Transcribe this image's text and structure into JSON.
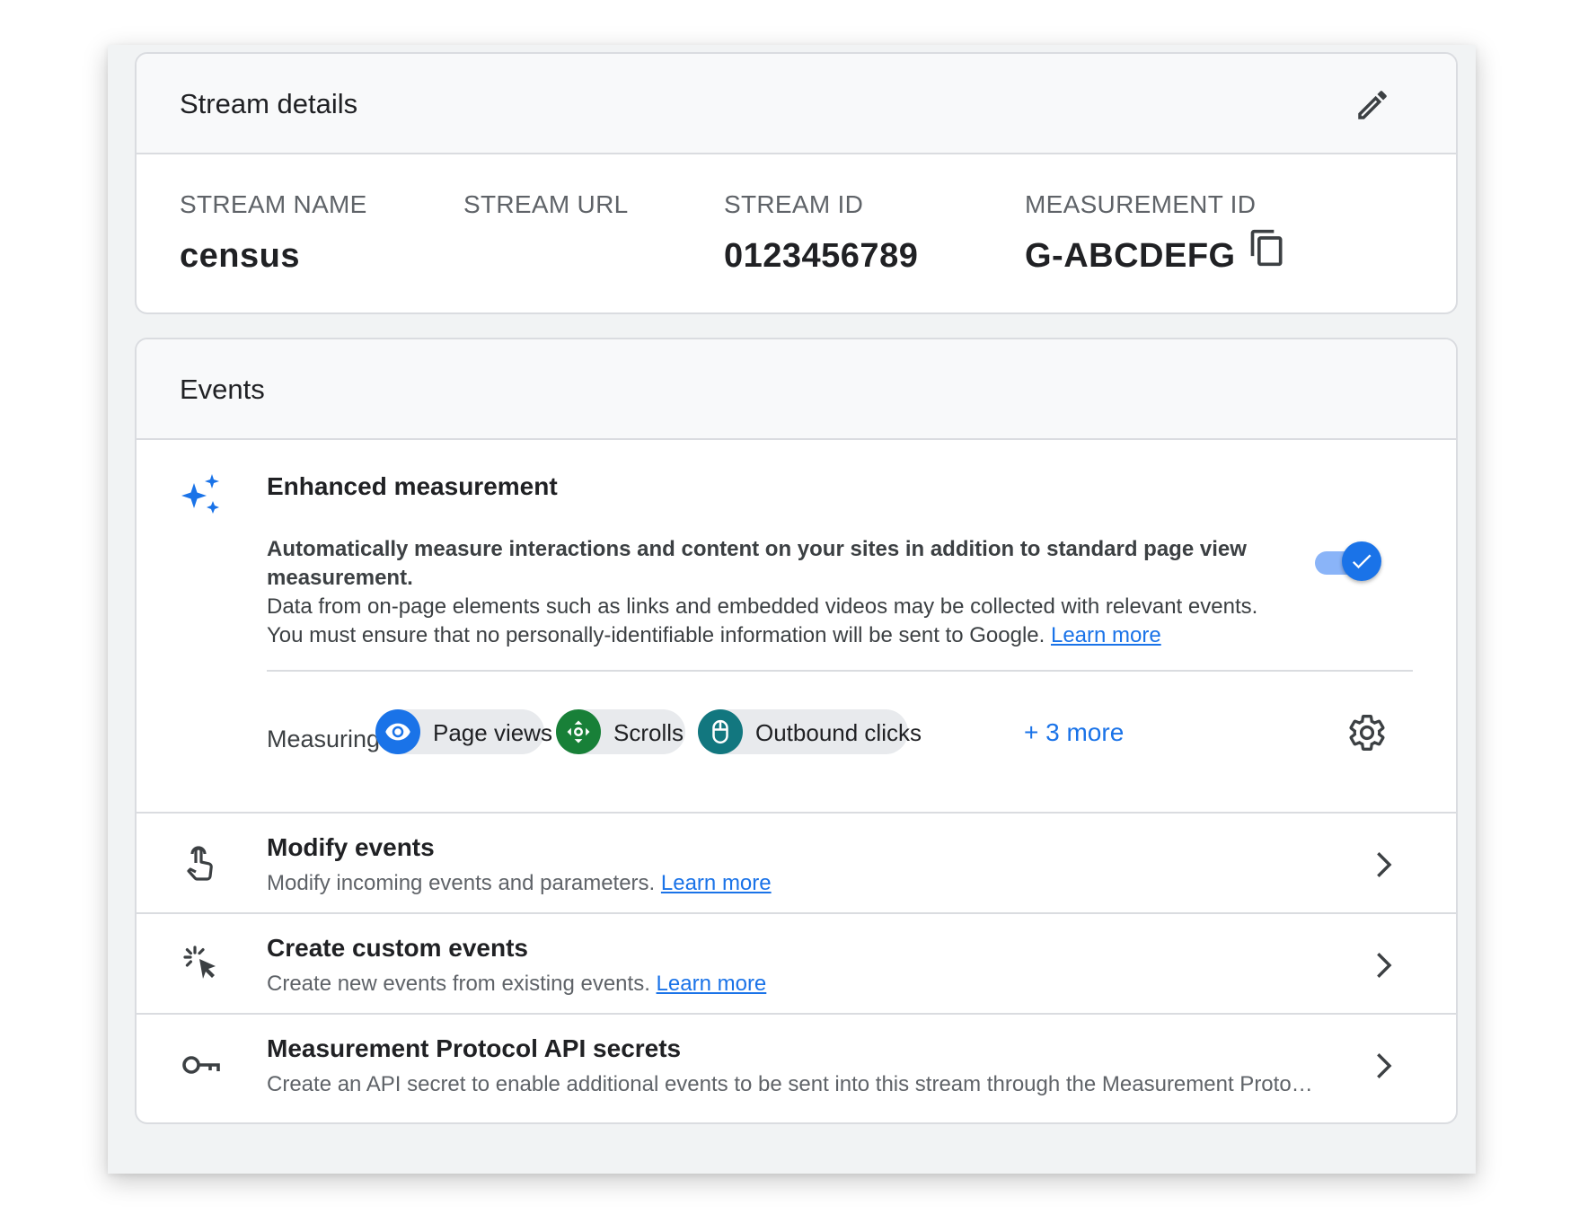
{
  "stream_details": {
    "title": "Stream details",
    "fields": [
      {
        "label": "STREAM NAME",
        "value": "census"
      },
      {
        "label": "STREAM URL",
        "value": ""
      },
      {
        "label": "STREAM ID",
        "value": "0123456789"
      },
      {
        "label": "MEASUREMENT ID",
        "value": "G-ABCDEFG"
      }
    ],
    "edit_icon": "pencil-icon",
    "copy_icon": "copy-icon"
  },
  "events": {
    "title": "Events",
    "enhanced_measurement": {
      "title": "Enhanced measurement",
      "icon": "sparkle-icon",
      "description_strong": "Automatically measure interactions and content on your sites in addition to standard page view measurement.",
      "description_line1": "Data from on-page elements such as links and embedded videos may be collected with relevant events.",
      "description_line2": "You must ensure that no personally-identifiable information will be sent to Google.",
      "learn_more": "Learn more",
      "enabled": true,
      "measuring_label": "Measuring:",
      "chips": [
        {
          "label": "Page views",
          "icon": "eye-icon",
          "color": "#1a73e8"
        },
        {
          "label": "Scrolls",
          "icon": "scroll-arrows-icon",
          "color": "#188038"
        },
        {
          "label": "Outbound clicks",
          "icon": "mouse-icon",
          "color": "#12777f"
        }
      ],
      "more": "+ 3 more",
      "settings_icon": "gear-icon"
    },
    "rows": [
      {
        "title": "Modify events",
        "subtitle": "Modify incoming events and parameters.",
        "learn_more": "Learn more",
        "icon": "touch-hand-icon"
      },
      {
        "title": "Create custom events",
        "subtitle": "Create new events from existing events.",
        "learn_more": "Learn more",
        "icon": "click-cursor-icon"
      },
      {
        "title": "Measurement Protocol API secrets",
        "subtitle": "Create an API secret to enable additional events to be sent into this stream through the Measurement Protocol.",
        "learn_more": "",
        "icon": "key-icon"
      }
    ]
  },
  "colors": {
    "accent": "#1a73e8",
    "toggle_track": "#8ab4f8",
    "border": "#dadce0",
    "header_bg": "#f8f9fa"
  }
}
